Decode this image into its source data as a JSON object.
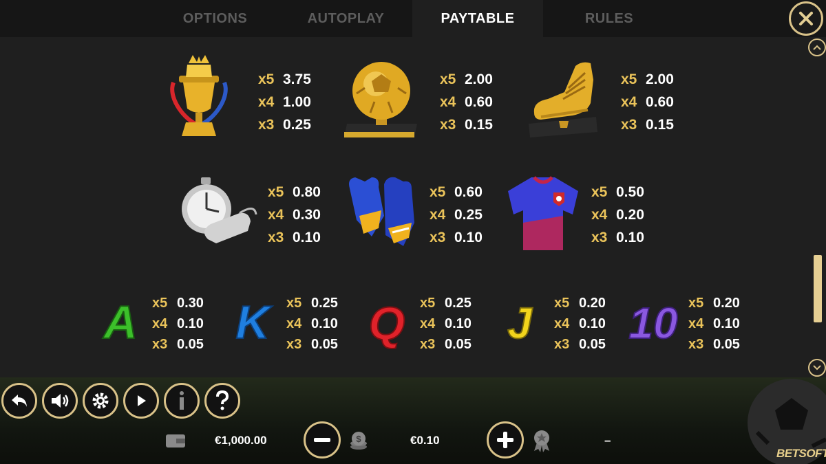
{
  "tabs": [
    {
      "label": "OPTIONS"
    },
    {
      "label": "AUTOPLAY"
    },
    {
      "label": "PAYTABLE"
    },
    {
      "label": "RULES"
    }
  ],
  "active_tab": "PAYTABLE",
  "paytable": {
    "trophy": {
      "icon": "trophy-icon",
      "x5": "3.75",
      "x4": "1.00",
      "x3": "0.25"
    },
    "ball": {
      "icon": "golden-ball-icon",
      "x5": "2.00",
      "x4": "0.60",
      "x3": "0.15"
    },
    "boot": {
      "icon": "golden-boot-icon",
      "x5": "2.00",
      "x4": "0.60",
      "x3": "0.15"
    },
    "stopwatch": {
      "icon": "stopwatch-whistle-icon",
      "x5": "0.80",
      "x4": "0.30",
      "x3": "0.10"
    },
    "gloves": {
      "icon": "goalkeeper-gloves-icon",
      "x5": "0.60",
      "x4": "0.25",
      "x3": "0.10"
    },
    "jersey": {
      "icon": "jersey-icon",
      "x5": "0.50",
      "x4": "0.20",
      "x3": "0.10"
    },
    "A": {
      "letter": "A",
      "color": "#3cbf2a",
      "x5": "0.30",
      "x4": "0.10",
      "x3": "0.05"
    },
    "K": {
      "letter": "K",
      "color": "#1f7fe0",
      "x5": "0.25",
      "x4": "0.10",
      "x3": "0.05"
    },
    "Q": {
      "letter": "Q",
      "color": "#e0222a",
      "x5": "0.25",
      "x4": "0.10",
      "x3": "0.05"
    },
    "J": {
      "letter": "J",
      "color": "#f2d41c",
      "x5": "0.20",
      "x4": "0.10",
      "x3": "0.05"
    },
    "10": {
      "letter": "10",
      "color": "#8a58e0",
      "x5": "0.20",
      "x4": "0.10",
      "x3": "0.05"
    }
  },
  "multipliers": {
    "x5": "x5",
    "x4": "x4",
    "x3": "x3"
  },
  "bottom": {
    "balance": "€1,000.00",
    "bet": "€0.10",
    "win": "–",
    "logo": "BETSOFT"
  },
  "colors": {
    "accent": "#d9c289",
    "multiplier": "#eac35a",
    "background": "#1f1f1f"
  }
}
